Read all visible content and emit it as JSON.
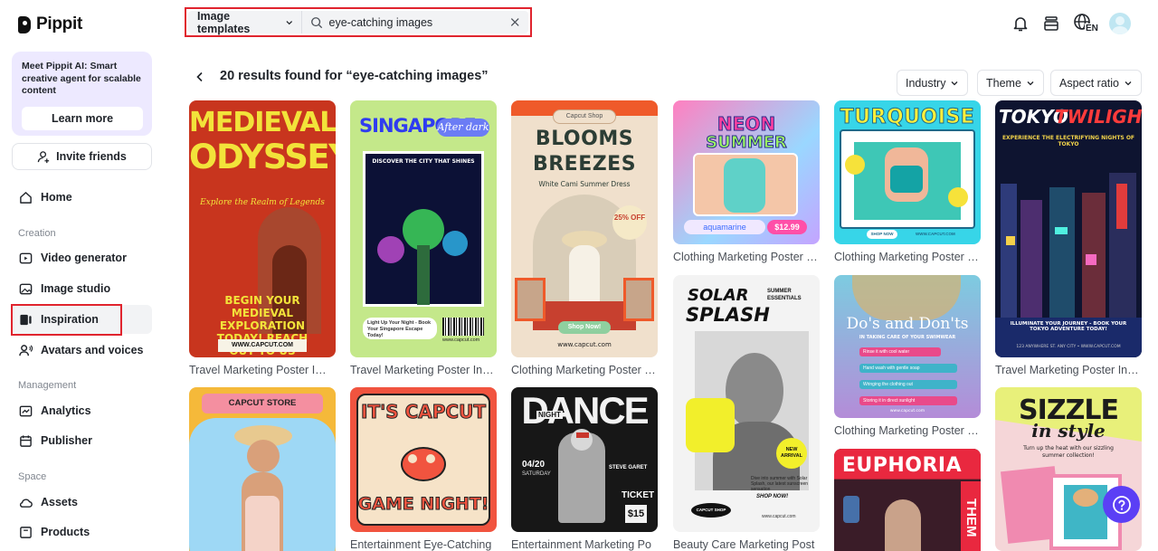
{
  "app": {
    "name": "Pippit"
  },
  "promo": {
    "text": "Meet Pippit AI: Smart creative agent for scalable content",
    "button": "Learn more"
  },
  "invite": {
    "label": "Invite friends"
  },
  "nav": {
    "home": "Home",
    "section_creation": "Creation",
    "video_generator": "Video generator",
    "image_studio": "Image studio",
    "inspiration": "Inspiration",
    "avatars_voices": "Avatars and voices",
    "section_management": "Management",
    "analytics": "Analytics",
    "publisher": "Publisher",
    "section_space": "Space",
    "assets": "Assets",
    "products": "Products"
  },
  "search": {
    "category": "Image templates",
    "query": "eye-catching images"
  },
  "topbar": {
    "lang": "EN"
  },
  "results": {
    "title": "20 results found for “eye-catching images”",
    "filters": [
      "Industry",
      "Theme",
      "Aspect ratio"
    ]
  },
  "cards": [
    {
      "title": "Travel Marketing Poster IG Ed",
      "l1": "MEDIEVAL",
      "l2": "ODYSSEY",
      "l3": "Explore the Realm of Legends",
      "l4": "BEGIN YOUR MEDIEVAL EXPLORATION TODAY! REACH OUT TO US",
      "l5": "WWW.CAPCUT.COM"
    },
    {
      "title": "Travel Marketing Poster Insta",
      "l1": "SINGAPORE",
      "l2": "After dark",
      "l3": "DISCOVER THE CITY THAT SHINES",
      "l4": "Light Up Your Night - Book Your Singapore Escape Today!",
      "l5": "www.capcut.com"
    },
    {
      "title": "Clothing Marketing Poster Ed",
      "l1": "Capcut Shop",
      "l2": "BLOOMS",
      "l3": "BREEZES",
      "l4": "White Cami Summer Dress",
      "l5": "25% OFF",
      "l6": "Shop Now!",
      "l7": "www.capcut.com"
    },
    {
      "title": "Clothing Marketing Poster Ed",
      "l1": "NEON",
      "l2": "SUMMER",
      "l3": "aquamarine",
      "l4": "$12.99"
    },
    {
      "title": "Clothing Marketing Poster Ed",
      "l1": "TURQUOISE",
      "l2": "SHOP NOW",
      "l3": "WWW.CAPCUT.COM"
    },
    {
      "title": "Travel Marketing Poster Insta",
      "l1": "TOKYO",
      "l2": "TWILIGHTS",
      "l3": "EXPERIENCE THE ELECTRIFYING NIGHTS OF TOKYO",
      "l4": "ILLUMINATE YOUR JOURNEY - BOOK YOUR TOKYO ADVENTURE TODAY!",
      "l5": "123 ANYWHERE ST. ANY CITY • WWW.CAPCUT.COM"
    },
    {
      "title": "",
      "l1": "CAPCUT STORE"
    },
    {
      "title": "Entertainment Eye-Catching",
      "l1": "IT'S CAPCUT",
      "l2": "GAME NIGHT!"
    },
    {
      "title": "Entertainment Marketing Po",
      "l1": "DANCE",
      "l2": "NIGHT",
      "l3": "04/20",
      "l4": "SATURDAY",
      "l5": "STEVE GARET",
      "l6": "TICKET",
      "l7": "$15"
    },
    {
      "title": "Beauty Care Marketing Post",
      "l1": "SOLAR",
      "l2": "SPLASH",
      "l3": "SUMMER ESSENTIALS",
      "l4": "NEW ARRIVAL",
      "l5": "Dive into summer with Solar Splash, our latest sunscreen sensation",
      "l6": "SHOP NOW!",
      "l7": "CAPCUT SHOP",
      "l8": "www.capcut.com"
    },
    {
      "title": "Clothing Marketing Poster Ed",
      "l1": "Do's and Don'ts",
      "l2": "IN TAKING CARE OF YOUR SWIMWEAR",
      "l3": "Rinse it with cool water",
      "l4": "Hand wash with gentle soap",
      "l5": "Wringing the clothing out",
      "l6": "Storing it in direct sunlight",
      "l7": "www.capcut.com"
    },
    {
      "title": "",
      "l1": "EUPHORIA",
      "l2": "THEM"
    },
    {
      "title": "",
      "l1": "SIZZLE",
      "l2": "in style",
      "l3": "Turn up the heat with our sizzling summer collection!"
    }
  ]
}
